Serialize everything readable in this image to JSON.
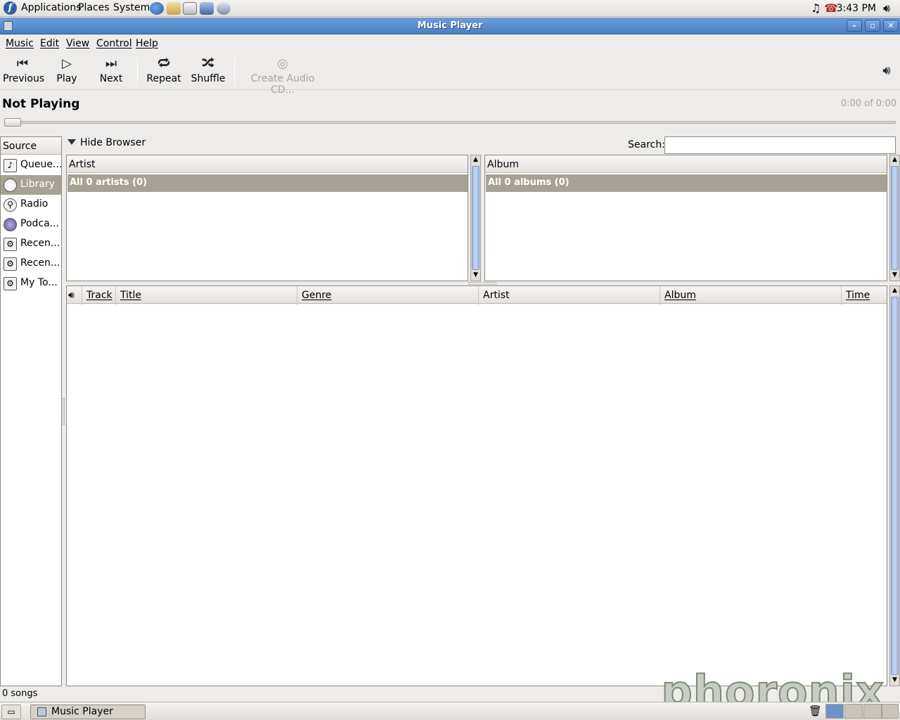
{
  "top_panel": {
    "menus": [
      "Applications",
      "Places",
      "System"
    ],
    "clock": "3:43 PM",
    "launcher_icons": [
      "web-browser-icon",
      "mail-client-icon",
      "text-editor-icon",
      "presentation-icon",
      "office-icon"
    ]
  },
  "window": {
    "title": "Music Player"
  },
  "menubar": [
    "Music",
    "Edit",
    "View",
    "Control",
    "Help"
  ],
  "toolbar": {
    "previous": "Previous",
    "play": "Play",
    "next": "Next",
    "repeat": "Repeat",
    "shuffle": "Shuffle",
    "create_cd": "Create Audio CD..."
  },
  "player": {
    "status": "Not Playing",
    "elapsed": "0:00 of 0:00",
    "seek_fraction": 0
  },
  "sources": {
    "header": "Source",
    "items": [
      "Queue...",
      "Library",
      "Radio",
      "Podca...",
      "Recen...",
      "Recen...",
      "My To..."
    ],
    "selected_index": 1
  },
  "browser": {
    "hide_label": "Hide Browser",
    "search_label": "Search:",
    "search_value": "",
    "artist_header": "Artist",
    "artist_all": "All 0 artists (0)",
    "album_header": "Album",
    "album_all": "All 0 albums (0)"
  },
  "track_columns": [
    "Track",
    "Title",
    "Genre",
    "Artist",
    "Album",
    "Time"
  ],
  "status_text": "0 songs",
  "taskbar": {
    "task": "Music Player"
  },
  "watermark": "phoronix",
  "colors": {
    "titlebar": "#5a8dcc",
    "selection": "#a8a294",
    "background": "#edeceb"
  }
}
